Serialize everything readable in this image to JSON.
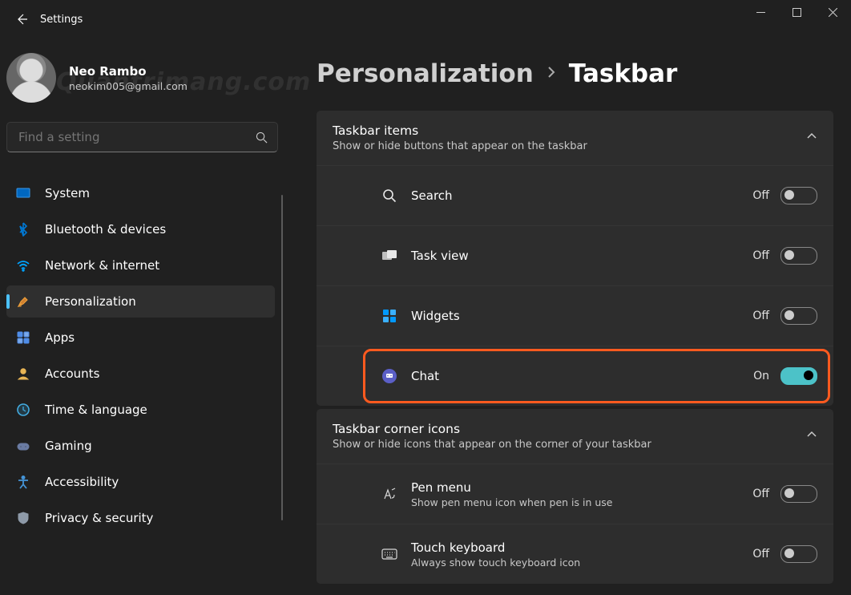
{
  "window": {
    "title": "Settings",
    "min": "Minimize",
    "max": "Maximize",
    "close": "Close"
  },
  "profile": {
    "name": "Neo Rambo",
    "email": "neokim005@gmail.com",
    "watermark": "Quantrimang.com"
  },
  "search": {
    "placeholder": "Find a setting"
  },
  "nav": [
    {
      "icon": "system-icon",
      "label": "System"
    },
    {
      "icon": "bluetooth-icon",
      "label": "Bluetooth & devices"
    },
    {
      "icon": "wifi-icon",
      "label": "Network & internet"
    },
    {
      "icon": "paintbrush-icon",
      "label": "Personalization",
      "selected": true
    },
    {
      "icon": "apps-icon",
      "label": "Apps"
    },
    {
      "icon": "accounts-icon",
      "label": "Accounts"
    },
    {
      "icon": "time-icon",
      "label": "Time & language"
    },
    {
      "icon": "gaming-icon",
      "label": "Gaming"
    },
    {
      "icon": "accessibility-icon",
      "label": "Accessibility"
    },
    {
      "icon": "shield-icon",
      "label": "Privacy & security"
    }
  ],
  "breadcrumb": {
    "parent": "Personalization",
    "current": "Taskbar"
  },
  "groups": [
    {
      "title": "Taskbar items",
      "sub": "Show or hide buttons that appear on the taskbar",
      "rows": [
        {
          "icon": "search-icon",
          "label": "Search",
          "state": "Off",
          "on": false
        },
        {
          "icon": "taskview-icon",
          "label": "Task view",
          "state": "Off",
          "on": false
        },
        {
          "icon": "widgets-icon",
          "label": "Widgets",
          "state": "Off",
          "on": false
        },
        {
          "icon": "chat-icon",
          "label": "Chat",
          "state": "On",
          "on": true,
          "highlight": true
        }
      ]
    },
    {
      "title": "Taskbar corner icons",
      "sub": "Show or hide icons that appear on the corner of your taskbar",
      "rows": [
        {
          "icon": "pen-icon",
          "label": "Pen menu",
          "sub": "Show pen menu icon when pen is in use",
          "state": "Off",
          "on": false
        },
        {
          "icon": "keyboard-icon",
          "label": "Touch keyboard",
          "sub": "Always show touch keyboard icon",
          "state": "Off",
          "on": false
        }
      ]
    }
  ]
}
